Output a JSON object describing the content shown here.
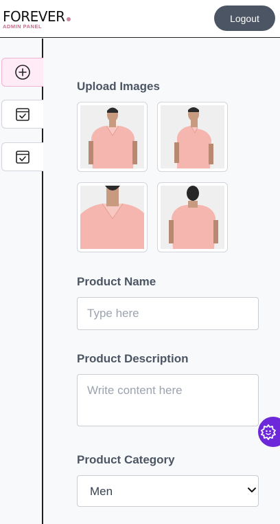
{
  "header": {
    "logo_title": "FOREVER",
    "logo_subtitle": "ADMIN PANEL",
    "logout_label": "Logout"
  },
  "sidebar": {
    "items": [
      {
        "icon": "add-circle-icon",
        "active": true
      },
      {
        "icon": "checklist-icon",
        "active": false
      },
      {
        "icon": "checklist-icon",
        "active": false
      }
    ]
  },
  "form": {
    "upload_label": "Upload Images",
    "images": [
      {
        "name": "front view"
      },
      {
        "name": "side view"
      },
      {
        "name": "collar close-up"
      },
      {
        "name": "back view"
      }
    ],
    "product_name_label": "Product Name",
    "product_name_placeholder": "Type here",
    "product_name_value": "",
    "description_label": "Product Description",
    "description_placeholder": "Write content here",
    "description_value": "",
    "category_label": "Product Category",
    "category_selected": "Men"
  },
  "colors": {
    "accent_pink": "#ffebf5",
    "logout_bg": "#4b5563",
    "shirt_pink": "#f4b6ae",
    "fab_purple": "#6d28d9"
  }
}
